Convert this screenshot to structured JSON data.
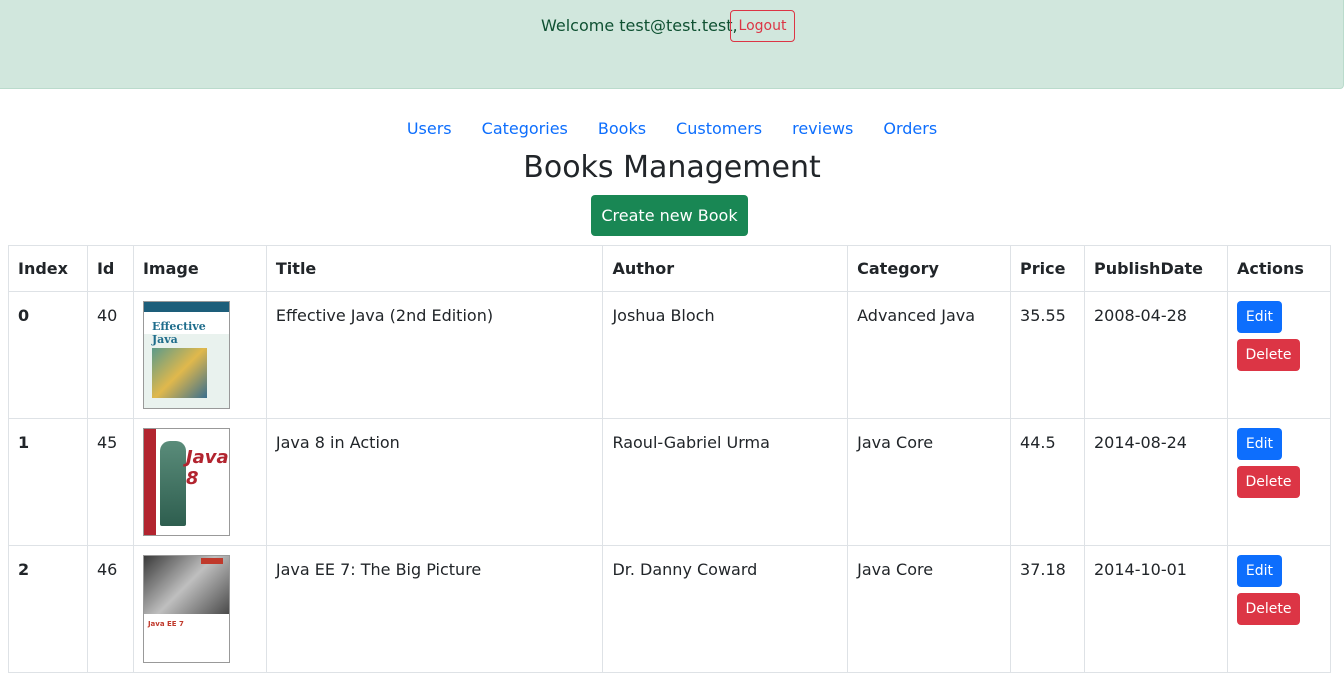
{
  "header": {
    "welcome_text": "Welcome test@test.test,",
    "logout_label": "Logout"
  },
  "nav": {
    "items": [
      "Users",
      "Categories",
      "Books",
      "Customers",
      "reviews",
      "Orders"
    ]
  },
  "page": {
    "title": "Books Management",
    "create_label": "Create new Book"
  },
  "table": {
    "columns": [
      "Index",
      "Id",
      "Image",
      "Title",
      "Author",
      "Category",
      "Price",
      "PublishDate",
      "Actions"
    ],
    "edit_label": "Edit",
    "delete_label": "Delete",
    "rows": [
      {
        "index": "0",
        "id": "40",
        "cover_title": "Effective Java",
        "title": "Effective Java (2nd Edition)",
        "author": "Joshua Bloch",
        "category": "Advanced Java",
        "price": "35.55",
        "publish_date": "2008-04-28"
      },
      {
        "index": "1",
        "id": "45",
        "cover_title": "Java 8",
        "title": "Java 8 in Action",
        "author": "Raoul-Gabriel Urma",
        "category": "Java Core",
        "price": "44.5",
        "publish_date": "2014-08-24"
      },
      {
        "index": "2",
        "id": "46",
        "cover_title": "Java EE 7",
        "title": "Java EE 7: The Big Picture",
        "author": "Dr. Danny Coward",
        "category": "Java Core",
        "price": "37.18",
        "publish_date": "2014-10-01"
      }
    ]
  },
  "colors": {
    "header_bg": "#d1e7dd",
    "link": "#0d6efd",
    "success": "#198754",
    "danger": "#dc3545",
    "primary": "#0d6efd"
  }
}
